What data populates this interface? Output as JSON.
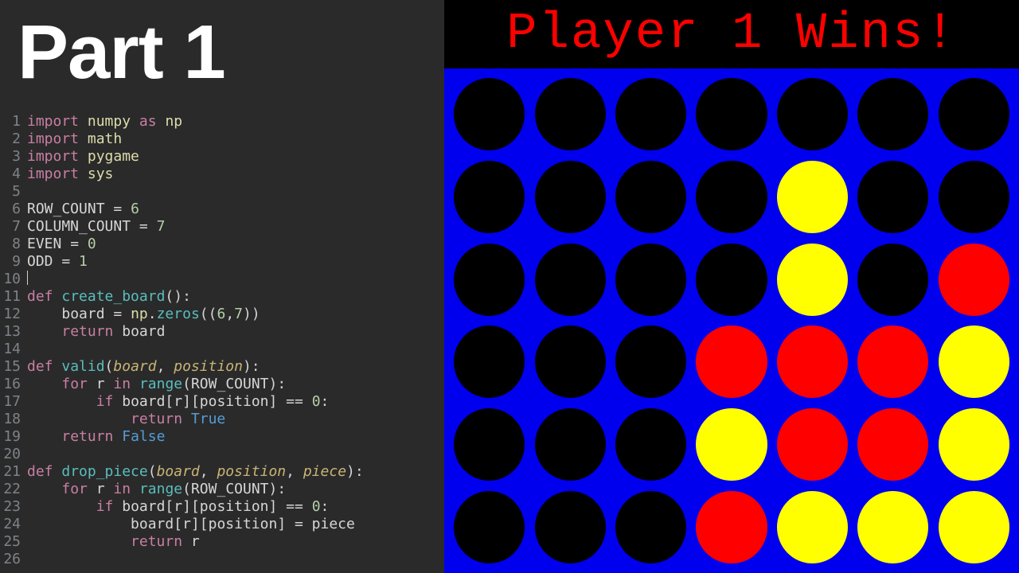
{
  "title": "Part 1",
  "code": {
    "lines": [
      {
        "n": 1,
        "tokens": [
          [
            "kw",
            "import"
          ],
          [
            "op",
            " "
          ],
          [
            "mod",
            "numpy"
          ],
          [
            "op",
            " "
          ],
          [
            "kw",
            "as"
          ],
          [
            "op",
            " "
          ],
          [
            "mod",
            "np"
          ]
        ]
      },
      {
        "n": 2,
        "tokens": [
          [
            "kw",
            "import"
          ],
          [
            "op",
            " "
          ],
          [
            "mod",
            "math"
          ]
        ]
      },
      {
        "n": 3,
        "tokens": [
          [
            "kw",
            "import"
          ],
          [
            "op",
            " "
          ],
          [
            "mod",
            "pygame"
          ]
        ]
      },
      {
        "n": 4,
        "tokens": [
          [
            "kw",
            "import"
          ],
          [
            "op",
            " "
          ],
          [
            "mod",
            "sys"
          ]
        ]
      },
      {
        "n": 5,
        "tokens": []
      },
      {
        "n": 6,
        "tokens": [
          [
            "var",
            "ROW_COUNT"
          ],
          [
            "op",
            " = "
          ],
          [
            "num",
            "6"
          ]
        ]
      },
      {
        "n": 7,
        "tokens": [
          [
            "var",
            "COLUMN_COUNT"
          ],
          [
            "op",
            " = "
          ],
          [
            "num",
            "7"
          ]
        ]
      },
      {
        "n": 8,
        "tokens": [
          [
            "var",
            "EVEN"
          ],
          [
            "op",
            " = "
          ],
          [
            "num",
            "0"
          ]
        ]
      },
      {
        "n": 9,
        "tokens": [
          [
            "var",
            "ODD"
          ],
          [
            "op",
            " = "
          ],
          [
            "num",
            "1"
          ]
        ]
      },
      {
        "n": 10,
        "tokens": [],
        "cursor": true
      },
      {
        "n": 11,
        "tokens": [
          [
            "kw",
            "def"
          ],
          [
            "op",
            " "
          ],
          [
            "fn",
            "create_board"
          ],
          [
            "op",
            "():"
          ]
        ]
      },
      {
        "n": 12,
        "tokens": [
          [
            "op",
            "    "
          ],
          [
            "var",
            "board"
          ],
          [
            "op",
            " = "
          ],
          [
            "mod",
            "np"
          ],
          [
            "op",
            "."
          ],
          [
            "fn",
            "zeros"
          ],
          [
            "op",
            "(("
          ],
          [
            "num",
            "6"
          ],
          [
            "op",
            ","
          ],
          [
            "num",
            "7"
          ],
          [
            "op",
            "))"
          ]
        ]
      },
      {
        "n": 13,
        "tokens": [
          [
            "op",
            "    "
          ],
          [
            "kw",
            "return"
          ],
          [
            "op",
            " "
          ],
          [
            "var",
            "board"
          ]
        ]
      },
      {
        "n": 14,
        "tokens": []
      },
      {
        "n": 15,
        "tokens": [
          [
            "kw",
            "def"
          ],
          [
            "op",
            " "
          ],
          [
            "fn",
            "valid"
          ],
          [
            "op",
            "("
          ],
          [
            "param",
            "board"
          ],
          [
            "op",
            ", "
          ],
          [
            "param",
            "position"
          ],
          [
            "op",
            "):"
          ]
        ]
      },
      {
        "n": 16,
        "tokens": [
          [
            "op",
            "    "
          ],
          [
            "kw",
            "for"
          ],
          [
            "op",
            " "
          ],
          [
            "var",
            "r"
          ],
          [
            "op",
            " "
          ],
          [
            "kw",
            "in"
          ],
          [
            "op",
            " "
          ],
          [
            "fn",
            "range"
          ],
          [
            "op",
            "("
          ],
          [
            "var",
            "ROW_COUNT"
          ],
          [
            "op",
            "):"
          ]
        ]
      },
      {
        "n": 17,
        "tokens": [
          [
            "op",
            "        "
          ],
          [
            "kw",
            "if"
          ],
          [
            "op",
            " "
          ],
          [
            "var",
            "board"
          ],
          [
            "op",
            "["
          ],
          [
            "var",
            "r"
          ],
          [
            "op",
            "]["
          ],
          [
            "var",
            "position"
          ],
          [
            "op",
            "] == "
          ],
          [
            "num",
            "0"
          ],
          [
            "op",
            ":"
          ]
        ]
      },
      {
        "n": 18,
        "tokens": [
          [
            "op",
            "            "
          ],
          [
            "kw",
            "return"
          ],
          [
            "op",
            " "
          ],
          [
            "bool",
            "True"
          ]
        ]
      },
      {
        "n": 19,
        "tokens": [
          [
            "op",
            "    "
          ],
          [
            "kw",
            "return"
          ],
          [
            "op",
            " "
          ],
          [
            "bool",
            "False"
          ]
        ]
      },
      {
        "n": 20,
        "tokens": []
      },
      {
        "n": 21,
        "tokens": [
          [
            "kw",
            "def"
          ],
          [
            "op",
            " "
          ],
          [
            "fn",
            "drop_piece"
          ],
          [
            "op",
            "("
          ],
          [
            "param",
            "board"
          ],
          [
            "op",
            ", "
          ],
          [
            "param",
            "position"
          ],
          [
            "op",
            ", "
          ],
          [
            "param",
            "piece"
          ],
          [
            "op",
            "):"
          ]
        ]
      },
      {
        "n": 22,
        "tokens": [
          [
            "op",
            "    "
          ],
          [
            "kw",
            "for"
          ],
          [
            "op",
            " "
          ],
          [
            "var",
            "r"
          ],
          [
            "op",
            " "
          ],
          [
            "kw",
            "in"
          ],
          [
            "op",
            " "
          ],
          [
            "fn",
            "range"
          ],
          [
            "op",
            "("
          ],
          [
            "var",
            "ROW_COUNT"
          ],
          [
            "op",
            "):"
          ]
        ]
      },
      {
        "n": 23,
        "tokens": [
          [
            "op",
            "        "
          ],
          [
            "kw",
            "if"
          ],
          [
            "op",
            " "
          ],
          [
            "var",
            "board"
          ],
          [
            "op",
            "["
          ],
          [
            "var",
            "r"
          ],
          [
            "op",
            "]["
          ],
          [
            "var",
            "position"
          ],
          [
            "op",
            "] == "
          ],
          [
            "num",
            "0"
          ],
          [
            "op",
            ":"
          ]
        ]
      },
      {
        "n": 24,
        "tokens": [
          [
            "op",
            "            "
          ],
          [
            "var",
            "board"
          ],
          [
            "op",
            "["
          ],
          [
            "var",
            "r"
          ],
          [
            "op",
            "]["
          ],
          [
            "var",
            "position"
          ],
          [
            "op",
            "] = "
          ],
          [
            "var",
            "piece"
          ]
        ]
      },
      {
        "n": 25,
        "tokens": [
          [
            "op",
            "            "
          ],
          [
            "kw",
            "return"
          ],
          [
            "op",
            " "
          ],
          [
            "var",
            "r"
          ]
        ]
      },
      {
        "n": 26,
        "tokens": []
      }
    ]
  },
  "game": {
    "winner_text": "Player 1 Wins!",
    "rows": 6,
    "cols": 7,
    "board": [
      [
        "empty",
        "empty",
        "empty",
        "empty",
        "empty",
        "empty",
        "empty"
      ],
      [
        "empty",
        "empty",
        "empty",
        "empty",
        "yellow",
        "empty",
        "empty"
      ],
      [
        "empty",
        "empty",
        "empty",
        "empty",
        "yellow",
        "empty",
        "red"
      ],
      [
        "empty",
        "empty",
        "empty",
        "red",
        "red",
        "red",
        "yellow"
      ],
      [
        "empty",
        "empty",
        "empty",
        "yellow",
        "red",
        "red",
        "yellow"
      ],
      [
        "empty",
        "empty",
        "empty",
        "red",
        "yellow",
        "yellow",
        "yellow"
      ]
    ]
  }
}
